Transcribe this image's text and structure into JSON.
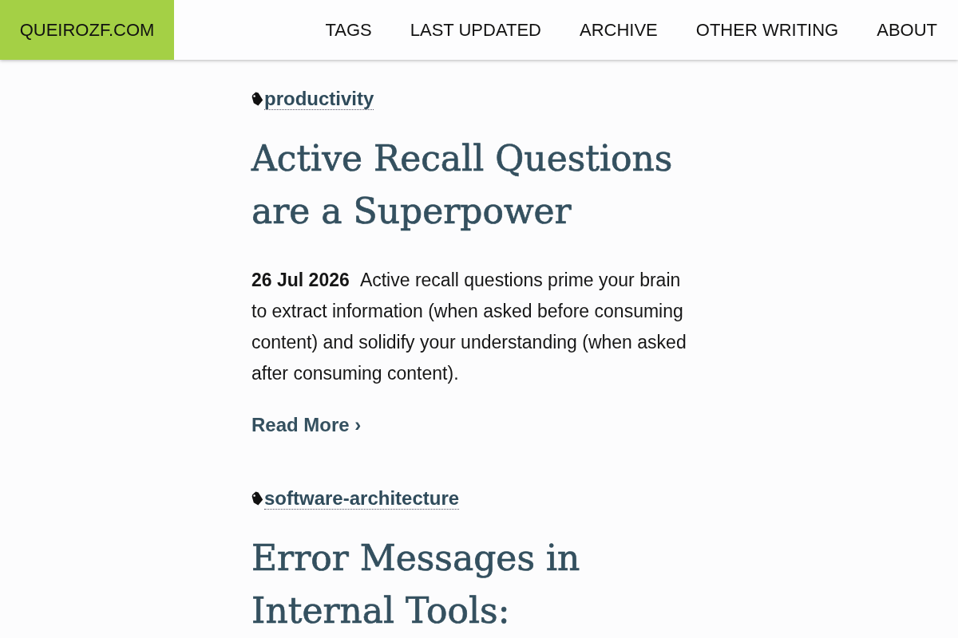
{
  "header": {
    "logo": "QUEIROZF.COM",
    "nav": [
      "TAGS",
      "LAST UPDATED",
      "ARCHIVE",
      "OTHER WRITING",
      "ABOUT"
    ]
  },
  "posts": [
    {
      "tag": "productivity",
      "title": "Active Recall Questions are a Superpower",
      "date": "26 Jul 2026",
      "summary": "Active recall questions prime your brain to extract information (when asked before consuming content) and solidify your understanding (when asked after consuming content).",
      "read_more": "Read More ›"
    },
    {
      "tag": "software-architecture",
      "title": "Error Messages in Internal Tools:"
    }
  ]
}
